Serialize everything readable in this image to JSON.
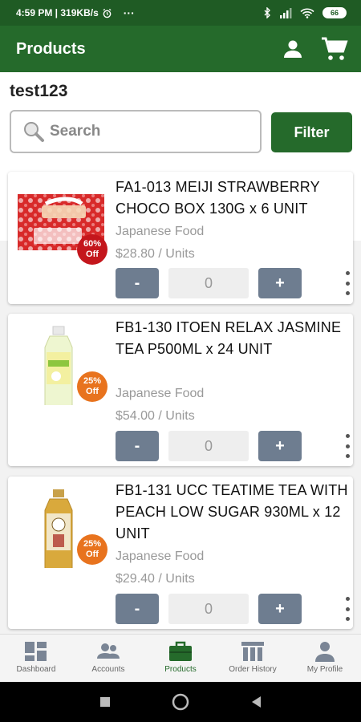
{
  "status_bar": {
    "time_info": "4:59 PM | 319KB/s",
    "more": "···",
    "battery": "66"
  },
  "app_bar": {
    "title": "Products",
    "profile_icon": "person-icon",
    "cart_icon": "cart-icon"
  },
  "account": {
    "name": "test123"
  },
  "search": {
    "placeholder": "Search",
    "icon": "search-icon"
  },
  "filter": {
    "label": "Filter"
  },
  "products": [
    {
      "name": "FA1-013 MEIJI STRAWBERRY CHOCO BOX 130G x 6 UNIT",
      "category": "Japanese Food",
      "price": "$28.80 / Units",
      "quantity": "0",
      "discount_pct": "60%",
      "discount_label": "Off",
      "badge_color": "#c4161c",
      "image_icon": "strawberry-choco-box-image"
    },
    {
      "name": "FB1-130 ITOEN RELAX JASMINE TEA P500ML x 24 UNIT",
      "category": "Japanese Food",
      "price": "$54.00 / Units",
      "quantity": "0",
      "discount_pct": "25%",
      "discount_label": "Off",
      "badge_color": "#e8731e",
      "image_icon": "jasmine-tea-bottle-image"
    },
    {
      "name": "FB1-131 UCC TEATIME TEA WITH PEACH LOW SUGAR 930ML x 12 UNIT",
      "category": "Japanese Food",
      "price": "$29.40 / Units",
      "quantity": "0",
      "discount_pct": "25%",
      "discount_label": "Off",
      "badge_color": "#e8731e",
      "image_icon": "peach-tea-bottle-image"
    }
  ],
  "qty_controls": {
    "minus": "-",
    "plus": "+"
  },
  "bottom_nav": [
    {
      "label": "Dashboard",
      "icon": "dashboard-icon"
    },
    {
      "label": "Accounts",
      "icon": "accounts-icon"
    },
    {
      "label": "Products",
      "icon": "briefcase-icon",
      "active": true
    },
    {
      "label": "Order History",
      "icon": "order-history-icon"
    },
    {
      "label": "My Profile",
      "icon": "profile-icon"
    }
  ],
  "colors": {
    "primary": "#256a2b",
    "status_bar": "#1f5b24",
    "qty_button": "#6e7d90"
  }
}
